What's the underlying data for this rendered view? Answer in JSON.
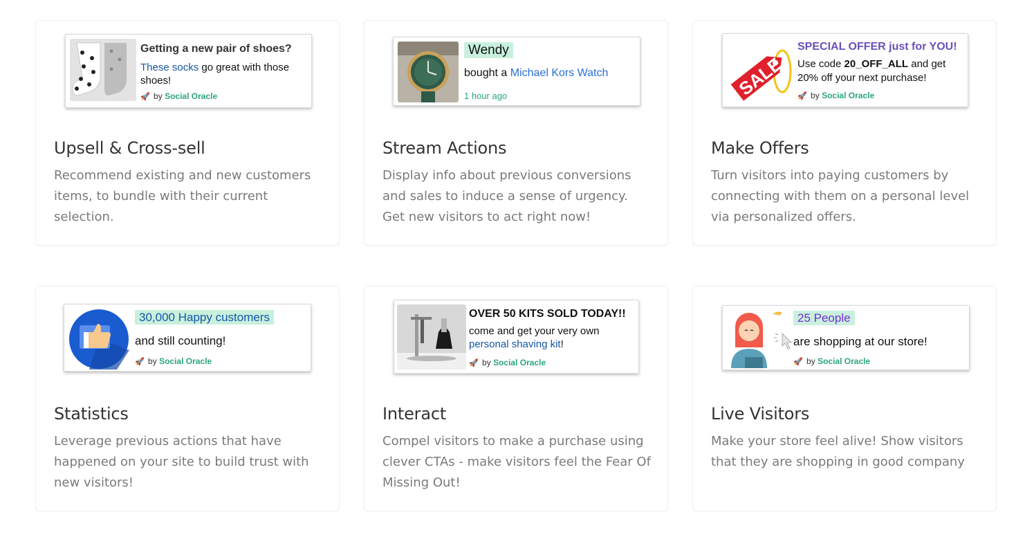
{
  "cards": [
    {
      "title": "Upsell & Cross-sell",
      "description": "Recommend existing and new customers items, to bundle with their current selection.",
      "notification": {
        "line1": "Getting a new pair of shoes?",
        "link": "These socks",
        "line2_rest": " go great with those shoes!",
        "by": "by",
        "brand": "Social Oracle",
        "thumb_icon": "socks-image"
      }
    },
    {
      "title": "Stream Actions",
      "description": "Display info about previous conversions and sales to induce a sense of urgency. Get new visitors to act right now!",
      "notification": {
        "name": "Wendy",
        "action": "bought a ",
        "product": "Michael Kors Watch",
        "time": "1 hour ago",
        "thumb_icon": "watch-image"
      }
    },
    {
      "title": "Make Offers",
      "description": "Turn visitors into paying customers by connecting with them on a personal level via personalized offers.",
      "notification": {
        "headline": "SPECIAL OFFER just for YOU!",
        "use_code": "Use code ",
        "code": "20_OFF_ALL",
        "code_rest": " and get 20% off your next purchase!",
        "by": "by",
        "brand": "Social Oracle",
        "tag_text": "SALE",
        "thumb_icon": "sale-tag-image"
      }
    },
    {
      "title": "Statistics",
      "description": "Leverage previous actions that have happened on your site to build trust with new visitors!",
      "notification": {
        "highlight": "30,000 Happy customers",
        "line2": "and still counting!",
        "by": "by",
        "brand": "Social Oracle",
        "thumb_icon": "thumbs-up-icon"
      }
    },
    {
      "title": "Interact",
      "description": "Compel visitors to make a purchase using clever CTAs - make visitors feel the Fear Of Missing Out!",
      "notification": {
        "headline": "OVER 50 KITS SOLD TODAY!!",
        "line2": "come and get your very own",
        "link": "personal shaving kit",
        "link_rest": "!",
        "by": "by",
        "brand": "Social Oracle",
        "thumb_icon": "shaving-kit-image"
      }
    },
    {
      "title": "Live Visitors",
      "description": "Make your store feel alive! Show visitors that they are shopping in good company",
      "notification": {
        "highlight": "25 People",
        "line2": "are shopping at our store!",
        "by": "by",
        "brand": "Social Oracle",
        "thumb_icon": "shopper-avatar-icon"
      }
    }
  ],
  "colors": {
    "highlight_bg": "#c8f0dd",
    "brand_green": "#2aa57a",
    "link_blue": "#1456a8",
    "offer_purple": "#6a50b8",
    "live_purple": "#7a2bd6"
  }
}
